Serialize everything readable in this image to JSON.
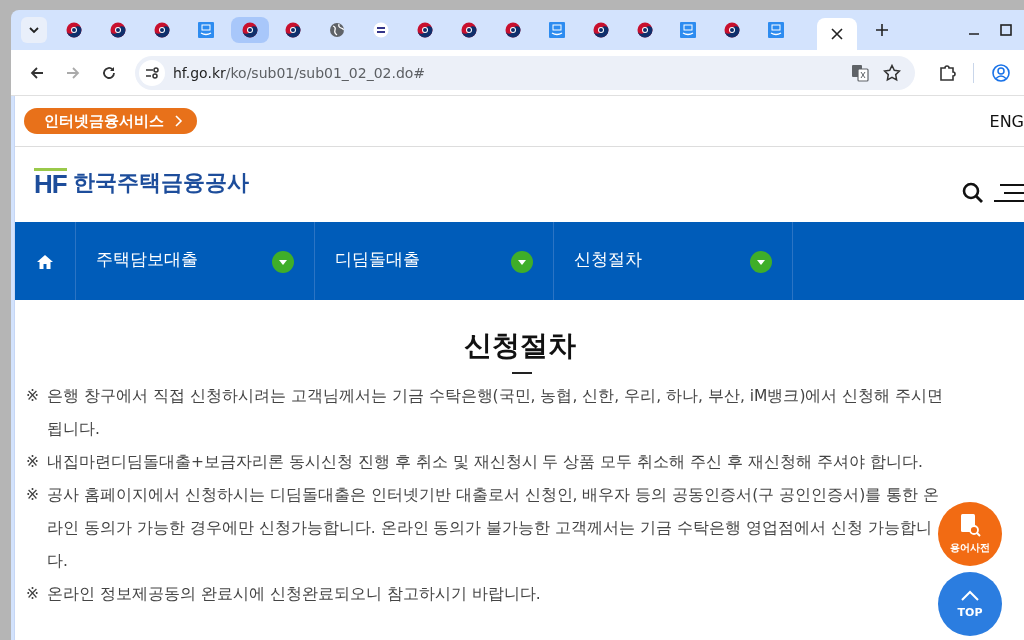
{
  "browser": {
    "tabs": [
      {
        "kind": "taeguk",
        "selected": false,
        "hovered": false
      },
      {
        "kind": "taeguk",
        "selected": false,
        "hovered": false
      },
      {
        "kind": "taeguk",
        "selected": false,
        "hovered": false
      },
      {
        "kind": "app",
        "selected": false,
        "hovered": false
      },
      {
        "kind": "taeguk",
        "selected": false,
        "hovered": true
      },
      {
        "kind": "taeguk",
        "selected": false,
        "hovered": false
      },
      {
        "kind": "globe",
        "selected": false,
        "hovered": false
      },
      {
        "kind": "seal",
        "selected": false,
        "hovered": false
      },
      {
        "kind": "taeguk",
        "selected": false,
        "hovered": false
      },
      {
        "kind": "taeguk",
        "selected": false,
        "hovered": false
      },
      {
        "kind": "taeguk",
        "selected": false,
        "hovered": false
      },
      {
        "kind": "app",
        "selected": false,
        "hovered": false
      },
      {
        "kind": "taeguk",
        "selected": false,
        "hovered": false
      },
      {
        "kind": "taeguk",
        "selected": false,
        "hovered": false
      },
      {
        "kind": "app",
        "selected": false,
        "hovered": false
      },
      {
        "kind": "taeguk",
        "selected": false,
        "hovered": false
      },
      {
        "kind": "app",
        "selected": false,
        "hovered": false
      },
      {
        "kind": "blank",
        "selected": true,
        "hovered": false
      }
    ],
    "url": {
      "host": "hf.go.kr",
      "path": "/ko/sub01/sub01_02_02.do#"
    }
  },
  "top_bar": {
    "service_button": "인터넷금융서비스",
    "language": "ENG"
  },
  "header": {
    "logo_mark": "HF",
    "logo_text": "한국주택금융공사"
  },
  "nav": {
    "items": [
      {
        "label": "주택담보대출"
      },
      {
        "label": "디딤돌대출"
      },
      {
        "label": "신청절차"
      }
    ]
  },
  "page": {
    "title": "신청절차",
    "notes": [
      {
        "mark": "※",
        "text": "은행 창구에서 직접 신청하시려는 고객님께서는 기금 수탁은행(국민, 농협, 신한, 우리, 하나, 부산, iM뱅크)에서 신청해 주시면 됩니다."
      },
      {
        "mark": "※",
        "text": "내집마련디딤돌대출+보금자리론 동시신청 진행 후 취소 및 재신청시 두 상품 모두 취소해 주신 후 재신청해 주셔야 합니다."
      },
      {
        "mark": "※",
        "text": "공사 홈페이지에서 신청하시는 디딤돌대출은 인터넷기반 대출로서 신청인, 배우자 등의 공동인증서(구 공인인증서)를 통한 온라인 동의가 가능한 경우에만 신청가능합니다. 온라인 동의가 불가능한 고객께서는 기금 수탁은행 영업점에서 신청 가능합니다."
      },
      {
        "mark": "※",
        "text": "온라인 정보제공동의 완료시에 신청완료되오니 참고하시기 바랍니다."
      }
    ]
  },
  "floating": {
    "glossary": "용어사전",
    "top": "TOP"
  }
}
